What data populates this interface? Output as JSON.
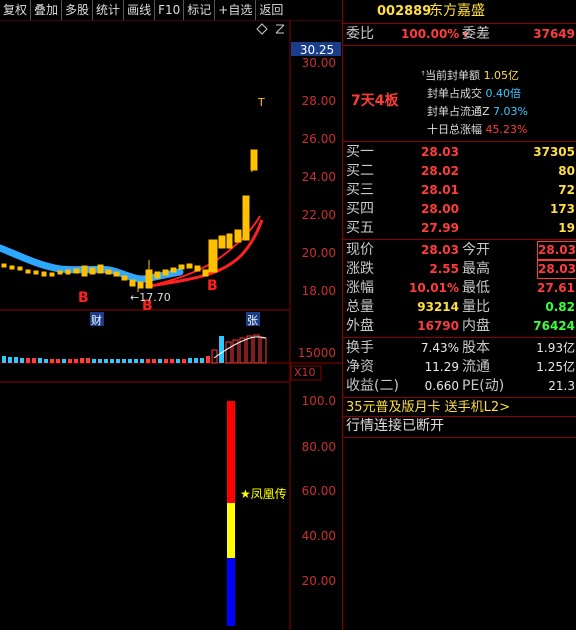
{
  "toolbar": {
    "items": [
      "复权",
      "叠加",
      "多股",
      "统计",
      "画线",
      "F10",
      "标记",
      "+自选",
      "返回"
    ]
  },
  "chart": {
    "current_price_box": "30.25",
    "price_ticks": [
      "30.00",
      "28.00",
      "26.00",
      "24.00",
      "22.00",
      "20.00",
      "18.00"
    ],
    "volume_tick": "15000",
    "volume_unit": "X10",
    "low_label": "←17.70",
    "buy_markers": [
      "B",
      "B",
      "B"
    ],
    "tag_cai": "财",
    "tag_zhang": "张",
    "top_marker": "T",
    "osc_ticks": [
      "100.0",
      "80.00",
      "60.00",
      "40.00",
      "20.00"
    ],
    "osc_label": "★凤凰传",
    "colors": {
      "up": "#ff3c3c",
      "up_fill": "#ffc000",
      "ma_blue": "#2ea8ff",
      "ma_red": "#ff2020",
      "osc_red": "#ff0000",
      "osc_yellow": "#ffff00",
      "osc_blue": "#0000ff"
    },
    "oscillator_segments": [
      {
        "color": "red",
        "from": 100,
        "to": 75
      },
      {
        "color": "yellow",
        "from": 75,
        "to": 51
      },
      {
        "color": "blue",
        "from": 51,
        "to": 0
      }
    ]
  },
  "header": {
    "code": "002889",
    "name": "东方嘉盛"
  },
  "weibi": {
    "label1": "委比",
    "value1": "100.00%",
    "label2": "委差",
    "value2": "37649"
  },
  "seal": {
    "streak": "7天4板",
    "lines": [
      {
        "label": "当前封单额",
        "value": "1.05亿",
        "color": "yellow"
      },
      {
        "label": "封单占成交",
        "value": "0.40倍",
        "color": "cyan"
      },
      {
        "label": "封单占流通Z",
        "value": "7.03%",
        "color": "cyan"
      },
      {
        "label": "十日总涨幅",
        "value": "45.23%",
        "color": "red"
      }
    ]
  },
  "ask_rows": [
    {
      "label": "卖一",
      "price": "",
      "vol": ""
    },
    {
      "label": "卖二",
      "price": "",
      "vol": ""
    },
    {
      "label": "卖三",
      "price": "",
      "vol": ""
    },
    {
      "label": "卖四",
      "price": "",
      "vol": ""
    },
    {
      "label": "卖五",
      "price": "",
      "vol": ""
    }
  ],
  "bid_rows": [
    {
      "label": "买一",
      "price": "28.03",
      "vol": "37305"
    },
    {
      "label": "买二",
      "price": "28.02",
      "vol": "80"
    },
    {
      "label": "买三",
      "price": "28.01",
      "vol": "72"
    },
    {
      "label": "买四",
      "price": "28.00",
      "vol": "173"
    },
    {
      "label": "买五",
      "price": "27.99",
      "vol": "19"
    }
  ],
  "quote": [
    {
      "l1": "现价",
      "v1": "28.03",
      "c1": "red",
      "l2": "今开",
      "v2": "28.03",
      "c2": "red",
      "box": true
    },
    {
      "l1": "涨跌",
      "v1": "2.55",
      "c1": "red",
      "l2": "最高",
      "v2": "28.03",
      "c2": "red",
      "box": true
    },
    {
      "l1": "涨幅",
      "v1": "10.01%",
      "c1": "red",
      "l2": "最低",
      "v2": "27.61",
      "c2": "red",
      "box": false
    },
    {
      "l1": "总量",
      "v1": "93214",
      "c1": "yellow",
      "l2": "量比",
      "v2": "0.82",
      "c2": "green",
      "box": false
    },
    {
      "l1": "外盘",
      "v1": "16790",
      "c1": "red",
      "l2": "内盘",
      "v2": "76424",
      "c2": "green",
      "box": false
    }
  ],
  "fund": [
    {
      "l1": "换手",
      "v1": "7.43%",
      "l2": "股本",
      "v2": "1.93亿"
    },
    {
      "l1": "净资",
      "v1": "11.29",
      "l2": "流通",
      "v2": "1.25亿"
    },
    {
      "l1": "收益(二)",
      "v1": "0.660",
      "l2": "PE(动)",
      "v2": "21.3"
    }
  ],
  "promo": "35元普及版月卡 送手机L2>",
  "status": "行情连接已断开"
}
